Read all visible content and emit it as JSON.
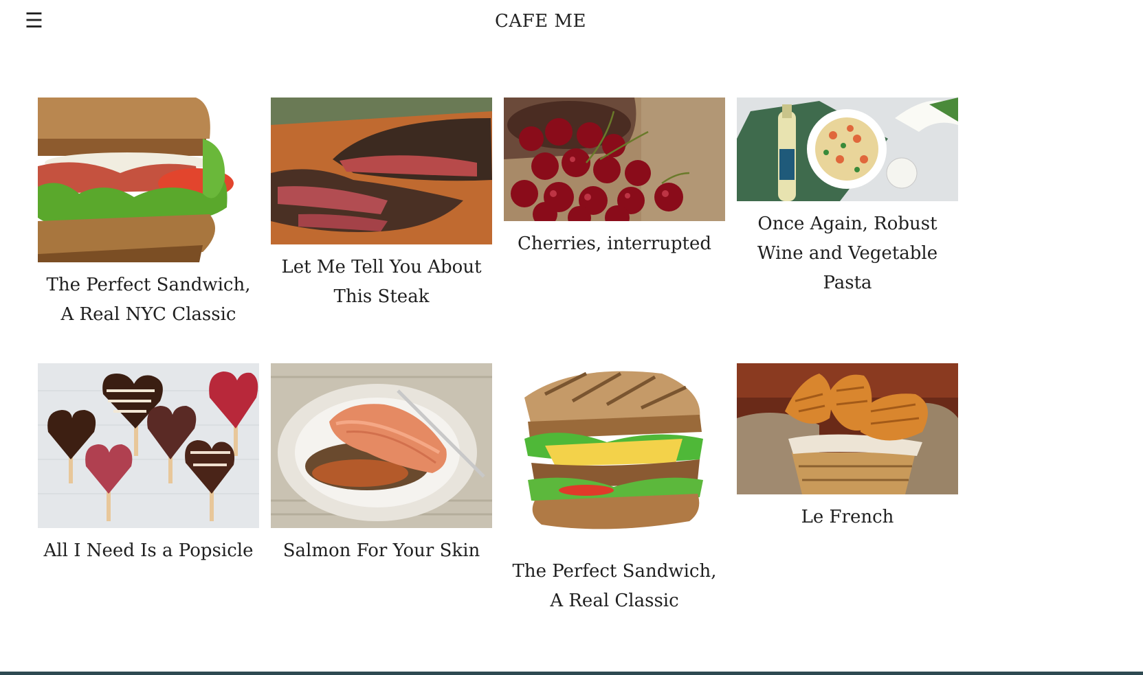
{
  "header": {
    "menu_icon": "hamburger-icon",
    "menu_glyph": "☰",
    "title": "CAFE ME"
  },
  "posts": [
    {
      "caption": "The Perfect Sandwich, A Real NYC Classic",
      "image": "blt-sandwich"
    },
    {
      "caption": "Let Me Tell You About This Steak",
      "image": "sliced-steak"
    },
    {
      "caption": "Cherries, interrupted",
      "image": "cherries-bowl"
    },
    {
      "caption": "Once Again, Robust Wine and Vegetable Pasta",
      "image": "wine-pasta"
    },
    {
      "caption": "All I Need Is a Popsicle",
      "image": "heart-popsicles"
    },
    {
      "caption": "Salmon For Your Skin",
      "image": "salmon-plate"
    },
    {
      "caption": "The Perfect Sandwich, A Real Classic",
      "image": "grilled-sandwich"
    },
    {
      "caption": "Le French",
      "image": "croissant-basket"
    }
  ],
  "colors": {
    "bottom_bar": "#2e4a52"
  }
}
